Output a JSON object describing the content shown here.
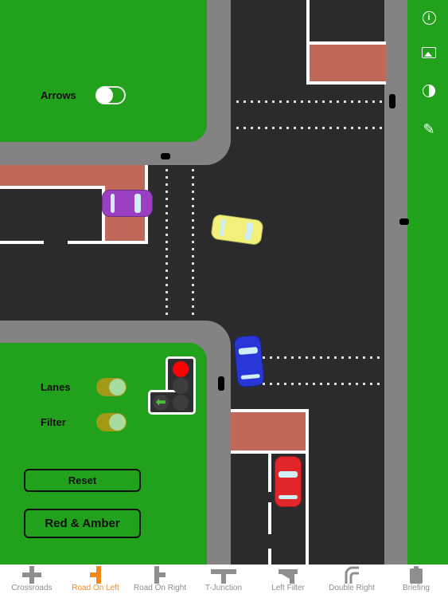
{
  "controls": {
    "arrows_label": "Arrows",
    "arrows_on": false,
    "lanes_label": "Lanes",
    "lanes_on": true,
    "filter_label": "Filter",
    "filter_on": true,
    "reset_label": "Reset",
    "phase_label": "Red & Amber"
  },
  "traffic_light": {
    "red": true,
    "amber": false,
    "green": false,
    "filter_arrow": false
  },
  "sidebar": {
    "icons": [
      "info-icon",
      "image-icon",
      "contrast-icon",
      "pencil-icon"
    ]
  },
  "tabs": [
    {
      "label": "Crossroads",
      "active": false
    },
    {
      "label": "Road On Left",
      "active": true
    },
    {
      "label": "Road On Right",
      "active": false
    },
    {
      "label": "T-Junction",
      "active": false
    },
    {
      "label": "Left Filter",
      "active": false
    },
    {
      "label": "Double Right",
      "active": false
    },
    {
      "label": "Briefing",
      "active": false
    }
  ],
  "colors": {
    "grass": "#22a11c",
    "road": "#2b2a2c",
    "pavement": "#858283",
    "active_tab": "#f28a1a",
    "inactive_tab": "#8e8e8e"
  }
}
